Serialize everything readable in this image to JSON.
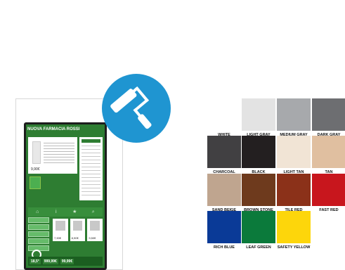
{
  "kiosk": {
    "title": "NUOVA FARMACIA ROSSI",
    "product_price": "9,90€",
    "thumbs": [
      "7,90€",
      "8,90€",
      "9,50€"
    ],
    "footer_values": [
      "18,5°",
      "999,99€",
      "99,99€"
    ]
  },
  "badge": {
    "icon": "paint-roller-icon",
    "color": "#1f95d1"
  },
  "swatches": [
    {
      "label": "WHITE",
      "color": "#ffffff"
    },
    {
      "label": "LIGHT GRAY",
      "color": "#e3e3e3"
    },
    {
      "label": "MEDIUM GRAY",
      "color": "#a7a9ac"
    },
    {
      "label": "DARK GRAY",
      "color": "#6d6e71"
    },
    {
      "label": "CHARCOAL",
      "color": "#414042"
    },
    {
      "label": "BLACK",
      "color": "#231f20"
    },
    {
      "label": "LIGHT TAN",
      "color": "#f1e4d5"
    },
    {
      "label": "TAN",
      "color": "#e0bfa0"
    },
    {
      "label": "SAND BEIGE",
      "color": "#bfa58f"
    },
    {
      "label": "BROWN STONE",
      "color": "#6e3a1d"
    },
    {
      "label": "TILE RED",
      "color": "#8b3119"
    },
    {
      "label": "FAST RED",
      "color": "#c8161d"
    },
    {
      "label": "RICH BLUE",
      "color": "#0a3a97"
    },
    {
      "label": "LEAF GREEN",
      "color": "#0b7a3b"
    },
    {
      "label": "SAFETY YELLOW",
      "color": "#fdd60b"
    }
  ]
}
